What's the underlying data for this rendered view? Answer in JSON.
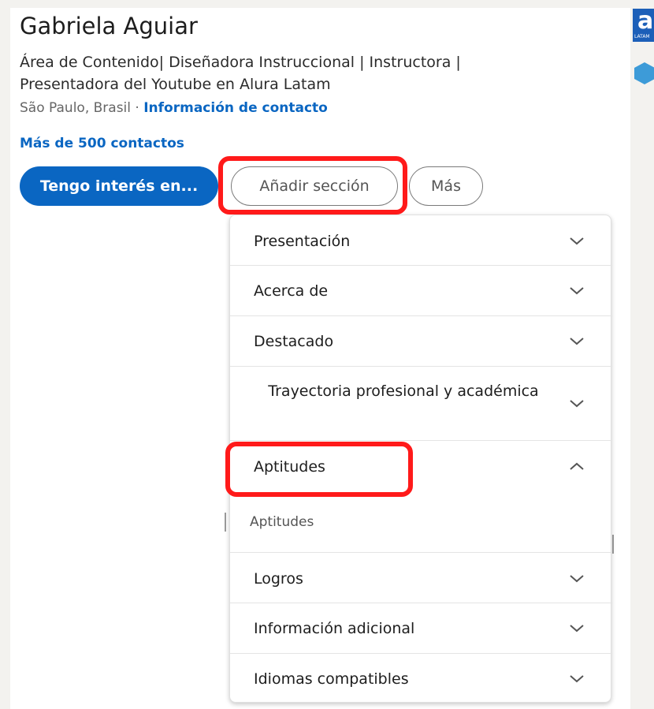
{
  "profile": {
    "name": "Gabriela Aguiar",
    "headline": "Área de Contenido| Diseñadora Instruccional | Instructora | Presentadora del Youtube en Alura Latam",
    "location": "São Paulo, Brasil · ",
    "contact_link": "Información de contacto",
    "contacts": "Más de 500 contactos"
  },
  "actions": {
    "interest_label": "Tengo interés en...",
    "add_section_label": "Añadir sección",
    "more_label": "Más"
  },
  "logo": {
    "letter": "a",
    "small_text": "LATAM"
  },
  "dropdown": {
    "items": [
      {
        "label": "Presentación",
        "chevron": "chevron-down-icon"
      },
      {
        "label": "Acerca de",
        "chevron": "chevron-down-icon"
      },
      {
        "label": "Destacado",
        "chevron": "chevron-down-icon"
      },
      {
        "label": "Trayectoria profesional y académica",
        "chevron": "chevron-down-icon"
      },
      {
        "label": "Aptitudes",
        "chevron": "chevron-up-icon",
        "expanded": true,
        "sub_items": [
          "Aptitudes"
        ]
      },
      {
        "label": "Logros",
        "chevron": "chevron-down-icon"
      },
      {
        "label": "Información adicional",
        "chevron": "chevron-down-icon"
      },
      {
        "label": "Idiomas compatibles",
        "chevron": "chevron-down-icon"
      }
    ]
  },
  "colors": {
    "primary": "#0a66c2",
    "highlight": "#ff1a1a"
  }
}
